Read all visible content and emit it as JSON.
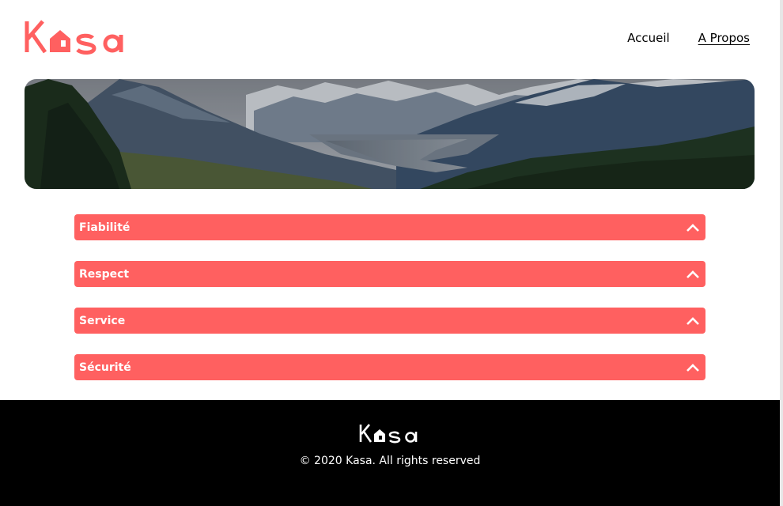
{
  "header": {
    "logo": {
      "text": "Kasa",
      "icon": "house-icon",
      "color": "#ff6060"
    },
    "nav": [
      {
        "label": "Accueil",
        "active": false
      },
      {
        "label": "A Propos",
        "active": true
      }
    ]
  },
  "banner": {
    "subject": "mountain-landscape"
  },
  "collapses": [
    {
      "title": "Fiabilité",
      "icon": "chevron-up-icon"
    },
    {
      "title": "Respect",
      "icon": "chevron-up-icon"
    },
    {
      "title": "Service",
      "icon": "chevron-up-icon"
    },
    {
      "title": "Sécurité",
      "icon": "chevron-up-icon"
    }
  ],
  "footer": {
    "logo": {
      "text": "Kasa",
      "color": "#ffffff"
    },
    "copyright": "© 2020 Kasa. All rights reserved"
  },
  "colors": {
    "accent": "#ff6060",
    "footer_bg": "#000000",
    "text": "#000000"
  }
}
